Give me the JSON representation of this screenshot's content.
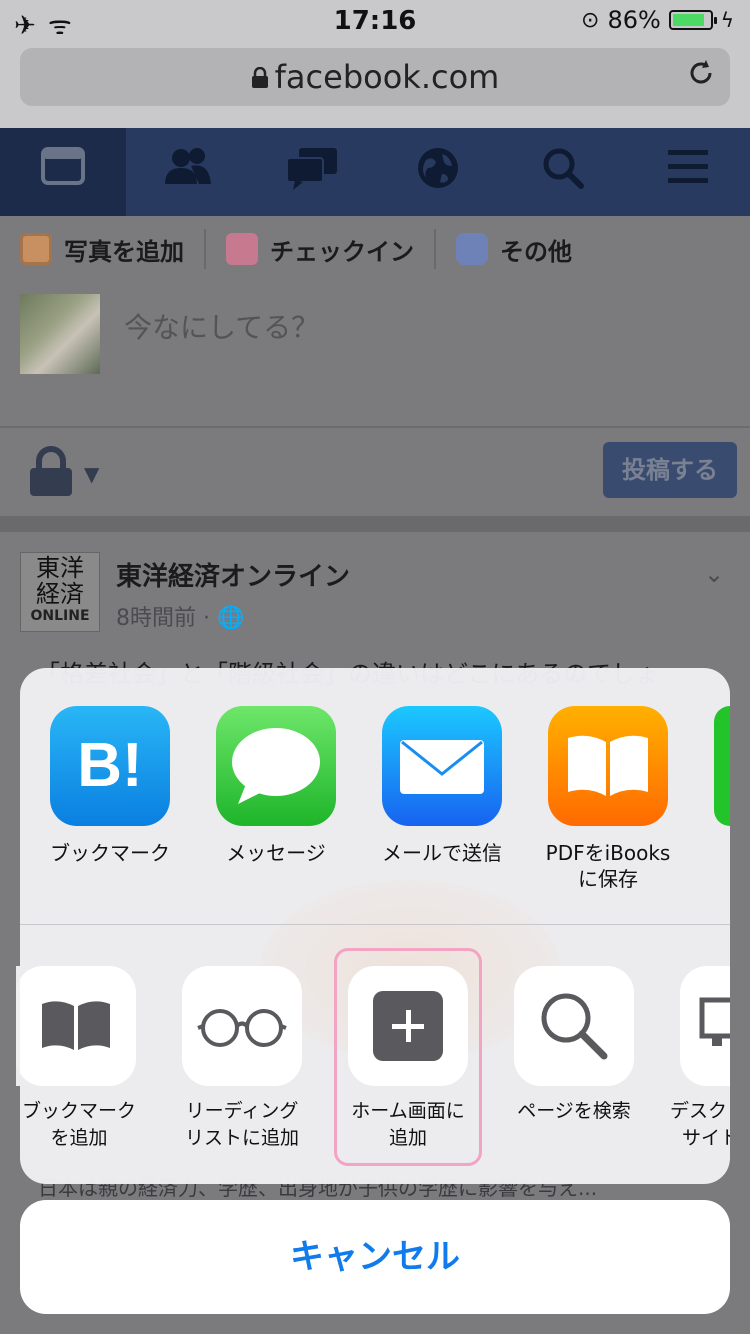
{
  "status_bar": {
    "left_icons": "✈ ᯤ",
    "time": "17:16",
    "battery_percent": "86%",
    "battery_level": 0.86
  },
  "browser": {
    "url": "facebook.com",
    "lock_icon": "lock-icon",
    "reload_icon": "reload-icon"
  },
  "fb_nav": {
    "tabs": [
      "news-feed-icon",
      "friends-icon",
      "messages-icon",
      "globe-icon",
      "search-icon",
      "menu-icon"
    ]
  },
  "composer": {
    "actions": [
      {
        "label": "写真を追加",
        "icon": "photo-icon",
        "color": "#d9a070"
      },
      {
        "label": "チェックイン",
        "icon": "location-pin-icon",
        "color": "#d98aa2"
      },
      {
        "label": "その他",
        "icon": "smiley-icon",
        "color": "#8a9ccf"
      }
    ],
    "placeholder": "今なにしてる？",
    "post_label": "投稿する"
  },
  "story": {
    "logo_lines": [
      "東洋",
      "経済",
      "ONLINE"
    ],
    "publisher": "東洋経済オンライン",
    "time": "8時間前 · 🌐",
    "text_line": "「格差社会」と「階級社会」の違いはどこにあるのでしょ",
    "text_line_bottom": "日本は親の経済力、学歴、出身地が子供の学歴に影響を与え..."
  },
  "share_sheet": {
    "apps": [
      {
        "label": "ブックマーク",
        "icon": "hatena-bookmark-icon",
        "color": "#1f9bea"
      },
      {
        "label": "メッセージ",
        "icon": "messages-app-icon",
        "color": "#4cd964"
      },
      {
        "label": "メールで送信",
        "icon": "mail-app-icon",
        "color": "#1e8ef5"
      },
      {
        "label": "PDFをiBooksに保存",
        "label_line1": "PDFをiBooks",
        "label_line2": "に保存",
        "icon": "ibooks-app-icon",
        "color": "#ff8c00"
      }
    ],
    "actions": [
      {
        "line1": "ブックマーク",
        "line2": "を追加",
        "icon": "book-icon"
      },
      {
        "line1": "リーディング",
        "line2": "リストに追加",
        "icon": "glasses-icon"
      },
      {
        "line1": "ホーム画面に",
        "line2": "追加",
        "icon": "add-square-icon"
      },
      {
        "line1": "ページを検索",
        "line2": "",
        "icon": "magnifier-icon"
      },
      {
        "line1": "デスク",
        "line2": "サイト",
        "icon": "desktop-icon"
      }
    ],
    "highlight_color": "#f3a3c4",
    "cancel_label": "キャンセル"
  }
}
